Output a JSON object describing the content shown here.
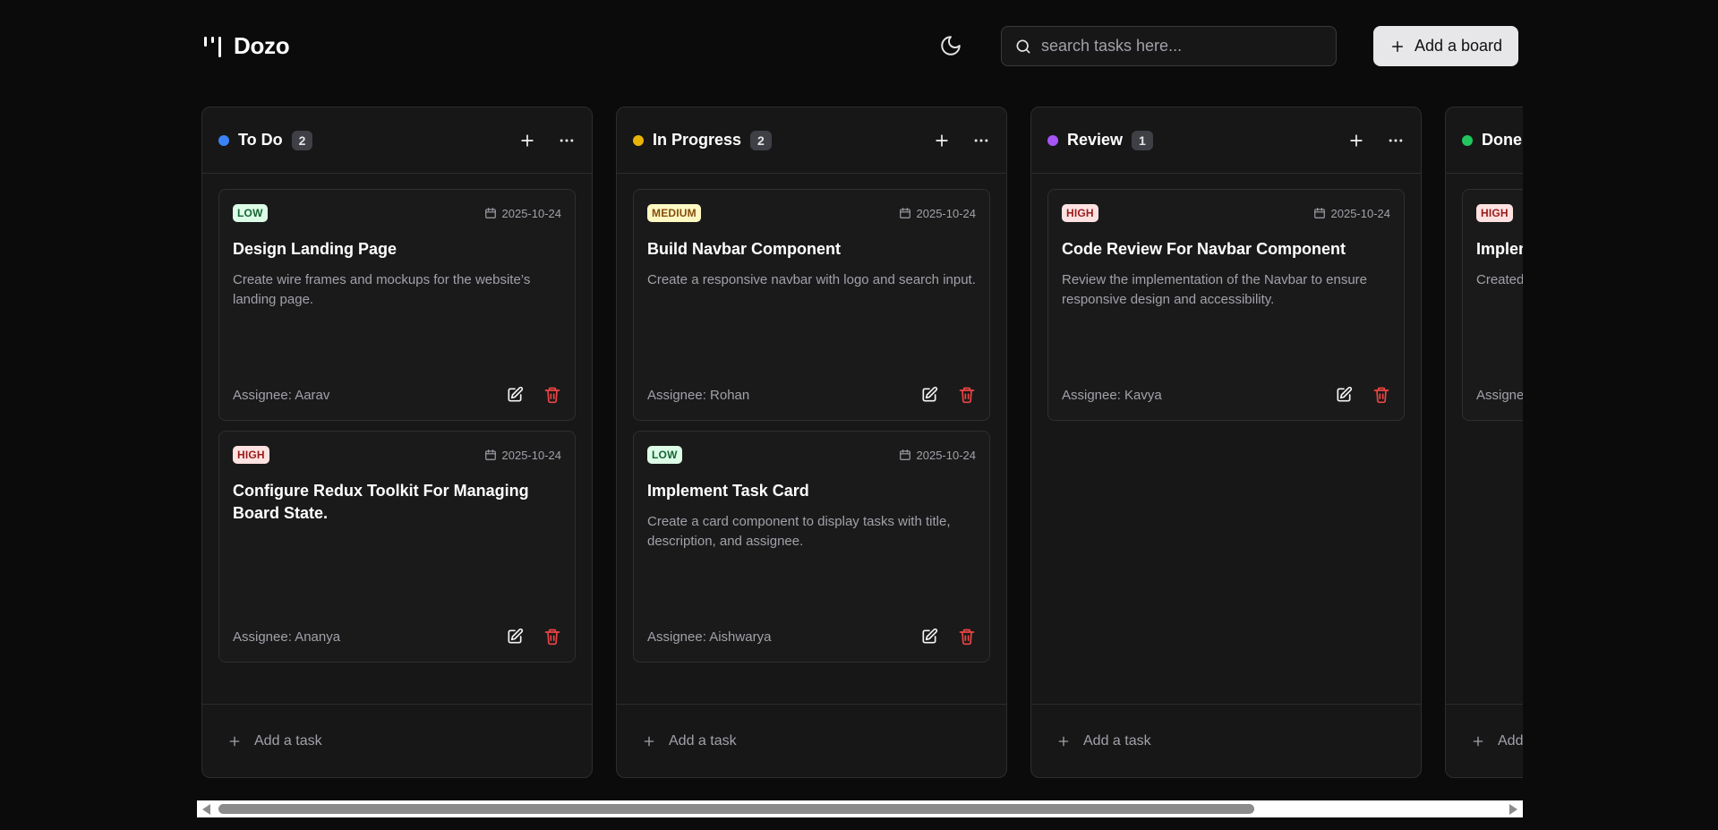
{
  "app": {
    "name": "Dozo"
  },
  "header": {
    "search_placeholder": "search tasks here...",
    "add_board_label": "Add a board"
  },
  "colors": {
    "todo": "#3b82f6",
    "in_progress": "#eab308",
    "review": "#a855f7",
    "done": "#22c55e",
    "delete": "#ef4444"
  },
  "columns": [
    {
      "title": "To Do",
      "count": "2",
      "dot_color": "#3b82f6",
      "add_task_label": "Add a task",
      "cards": [
        {
          "priority": "LOW",
          "date": "2025-10-24",
          "title": "Design Landing Page",
          "description": "Create wire frames and mockups for the website’s landing page.",
          "assignee": "Assignee: Aarav"
        },
        {
          "priority": "HIGH",
          "date": "2025-10-24",
          "title": "Configure Redux Toolkit For Managing Board State.",
          "description": "",
          "assignee": "Assignee: Ananya"
        }
      ]
    },
    {
      "title": "In Progress",
      "count": "2",
      "dot_color": "#eab308",
      "add_task_label": "Add a task",
      "cards": [
        {
          "priority": "MEDIUM",
          "date": "2025-10-24",
          "title": "Build Navbar Component",
          "description": "Create a responsive navbar with logo and search input.",
          "assignee": "Assignee: Rohan"
        },
        {
          "priority": "LOW",
          "date": "2025-10-24",
          "title": "Implement Task Card",
          "description": "Create a card component to display tasks with title, description, and assignee.",
          "assignee": "Assignee: Aishwarya"
        }
      ]
    },
    {
      "title": "Review",
      "count": "1",
      "dot_color": "#a855f7",
      "add_task_label": "Add a task",
      "cards": [
        {
          "priority": "HIGH",
          "date": "2025-10-24",
          "title": "Code Review For Navbar Component",
          "description": "Review the implementation of the Navbar to ensure responsive design and accessibility.",
          "assignee": "Assignee: Kavya"
        }
      ]
    },
    {
      "title": "Done",
      "count": "",
      "dot_color": "#22c55e",
      "add_task_label": "Add a task",
      "cards": [
        {
          "priority": "HIGH",
          "date": "",
          "title": "Implen",
          "description": "Created validati endpoir",
          "assignee": "Assigne"
        }
      ]
    }
  ],
  "priority_styles": {
    "LOW": {
      "bg": "#dcfce7",
      "fg": "#166534"
    },
    "MEDIUM": {
      "bg": "#fef9c3",
      "fg": "#854d0e"
    },
    "HIGH": {
      "bg": "#fee2e2",
      "fg": "#991b1b"
    }
  },
  "icons": {
    "logo": "dozo-logo-icon",
    "theme": "moon-icon",
    "search": "search-icon",
    "add": "plus-icon",
    "more": "more-horizontal-icon",
    "date": "calendar-icon",
    "edit": "edit-icon",
    "delete": "trash-icon"
  }
}
